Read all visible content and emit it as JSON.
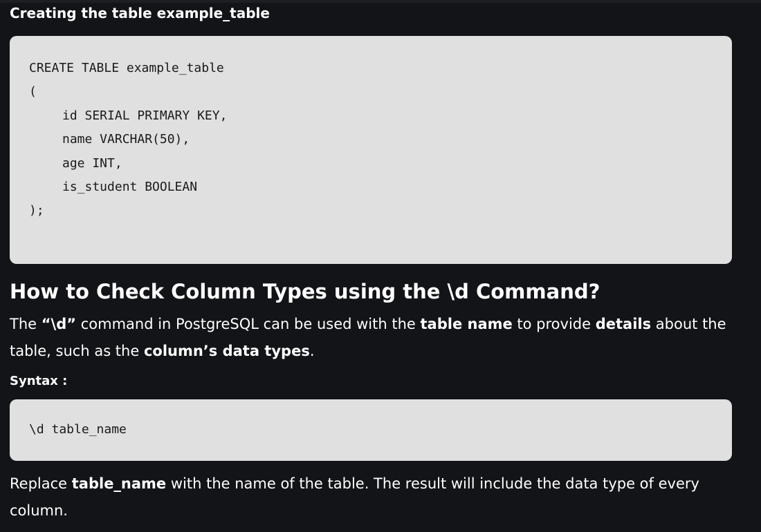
{
  "section_title": "Creating the table example_table",
  "create_code": {
    "lines": [
      "CREATE TABLE example_table",
      "(",
      "id SERIAL PRIMARY KEY,",
      "name VARCHAR(50),",
      "age INT,",
      "is_student BOOLEAN",
      ");"
    ]
  },
  "heading": "How to Check Column Types using the \\d Command?",
  "paragraph1": {
    "t1": "The ",
    "b1": "“\\d”",
    "t2": " command in PostgreSQL can be used with the ",
    "b2": "table name",
    "t3": " to provide ",
    "b3": "details",
    "t4": " about the table, such as the ",
    "b4": "column’s data types",
    "t5": "."
  },
  "syntax_label": "Syntax :",
  "syntax_code": "\\d table_name",
  "paragraph2": {
    "t1": "Replace ",
    "b1": "table_name",
    "t2": " with the name of the table. The result will include the data type of every column."
  }
}
